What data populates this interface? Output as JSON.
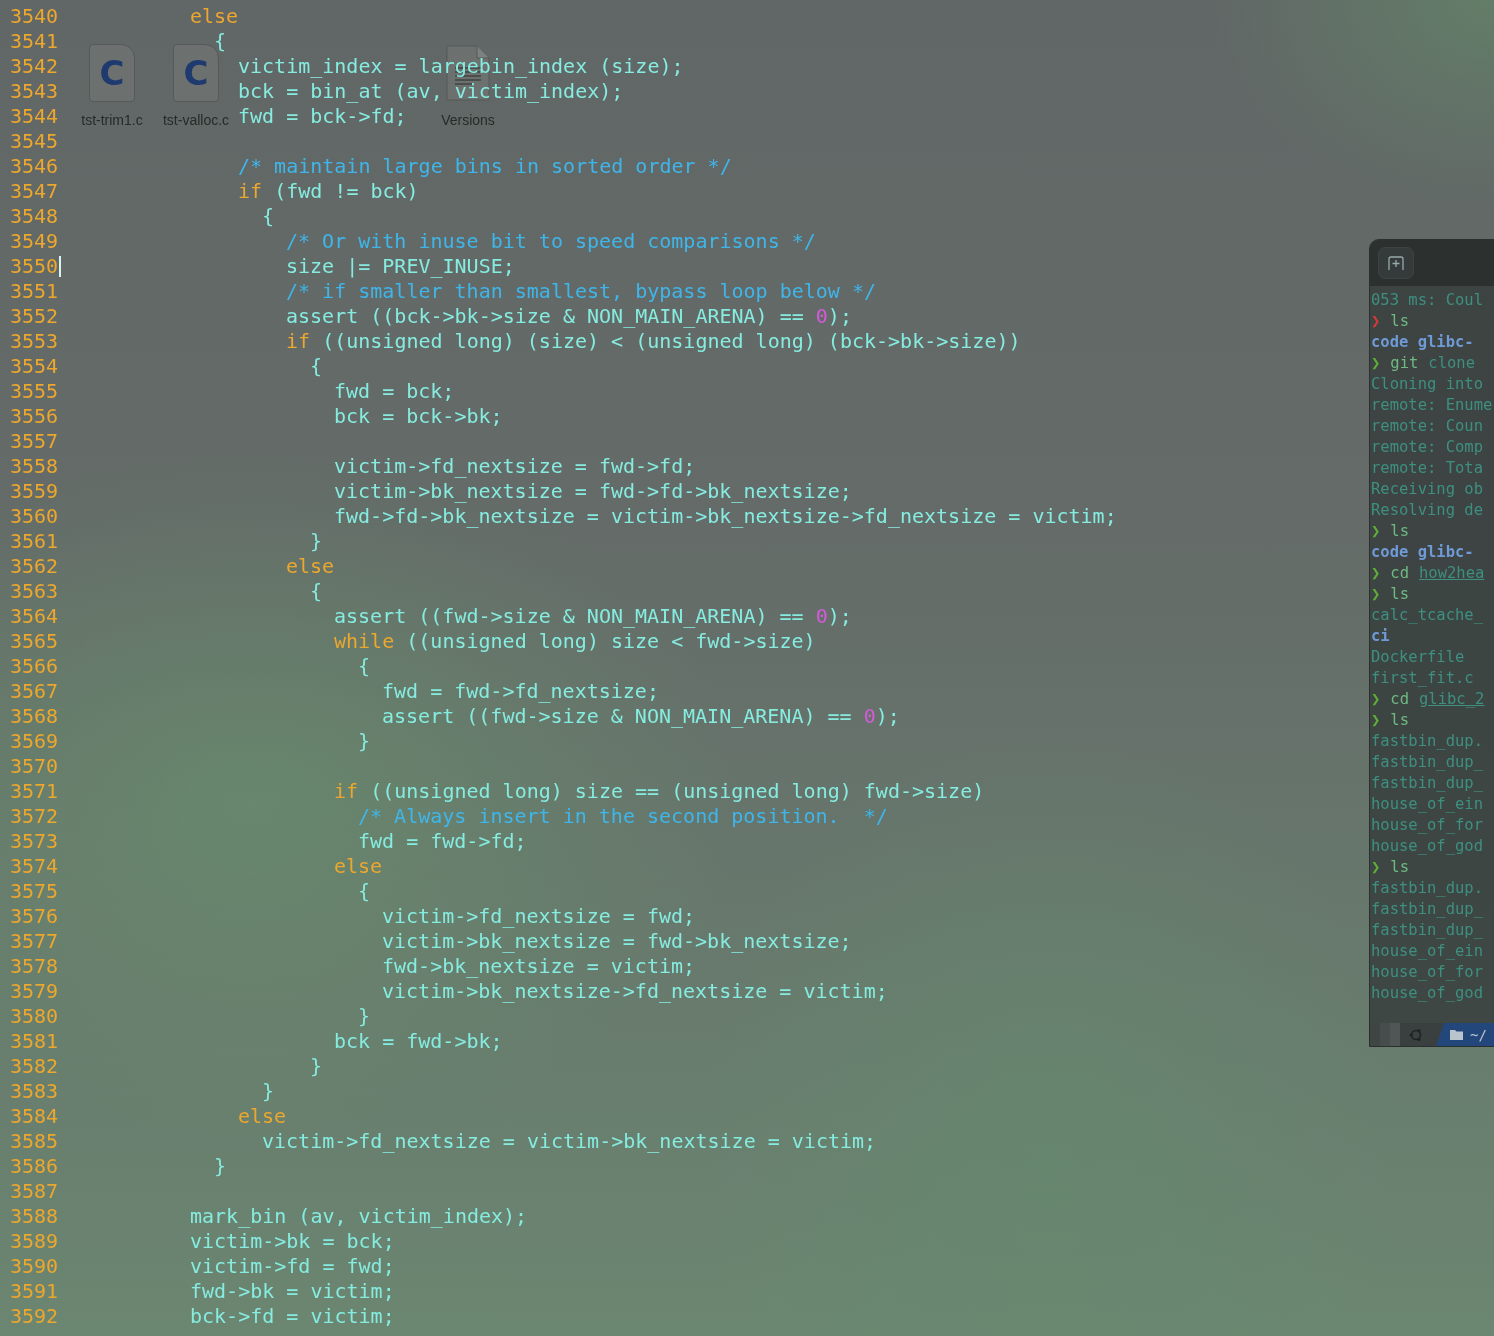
{
  "desktop": {
    "icons": [
      {
        "label": "tst-trim1.c",
        "kind": "c-source",
        "glyph": "C"
      },
      {
        "label": "tst-valloc.c",
        "kind": "c-source",
        "glyph": "C"
      },
      {
        "label": "Versions",
        "kind": "text"
      }
    ]
  },
  "editor": {
    "lines": [
      {
        "num": "3540",
        "cursor": false,
        "segments": [
          {
            "kind": "keyword",
            "text": "          else"
          }
        ]
      },
      {
        "num": "3541",
        "cursor": false,
        "segments": [
          {
            "kind": "plain",
            "text": "            {"
          }
        ]
      },
      {
        "num": "3542",
        "cursor": false,
        "segments": [
          {
            "kind": "plain",
            "text": "              victim_index = largebin_index (size);"
          }
        ]
      },
      {
        "num": "3543",
        "cursor": false,
        "segments": [
          {
            "kind": "plain",
            "text": "              bck = bin_at (av, victim_index);"
          }
        ]
      },
      {
        "num": "3544",
        "cursor": false,
        "segments": [
          {
            "kind": "plain",
            "text": "              fwd = bck->fd;"
          }
        ]
      },
      {
        "num": "3545",
        "cursor": false
      },
      {
        "num": "3546",
        "cursor": false,
        "segments": [
          {
            "kind": "comment",
            "text": "              /* maintain large bins in sorted order */"
          }
        ]
      },
      {
        "num": "3547",
        "cursor": false,
        "segments": [
          {
            "kind": "keyword",
            "text": "              if"
          },
          {
            "kind": "plain",
            "text": " (fwd != bck)"
          }
        ]
      },
      {
        "num": "3548",
        "cursor": false,
        "segments": [
          {
            "kind": "plain",
            "text": "                {"
          }
        ]
      },
      {
        "num": "3549",
        "cursor": false,
        "segments": [
          {
            "kind": "comment",
            "text": "                  /* Or with inuse bit to speed comparisons */"
          }
        ]
      },
      {
        "num": "3550",
        "cursor": true,
        "segments": [
          {
            "kind": "plain",
            "text": "                  size |= PREV_INUSE;"
          }
        ]
      },
      {
        "num": "3551",
        "cursor": false,
        "segments": [
          {
            "kind": "comment",
            "text": "                  /* if smaller than smallest, bypass loop below */"
          }
        ]
      },
      {
        "num": "3552",
        "cursor": false,
        "segments": [
          {
            "kind": "plain",
            "text": "                  assert ((bck->bk->size & NON_MAIN_ARENA) == "
          },
          {
            "kind": "number",
            "text": "0"
          },
          {
            "kind": "plain",
            "text": ");"
          }
        ]
      },
      {
        "num": "3553",
        "cursor": false,
        "segments": [
          {
            "kind": "keyword",
            "text": "                  if"
          },
          {
            "kind": "plain",
            "text": " ((unsigned long) (size) < (unsigned long) (bck->bk->size))"
          }
        ]
      },
      {
        "num": "3554",
        "cursor": false,
        "segments": [
          {
            "kind": "plain",
            "text": "                    {"
          }
        ]
      },
      {
        "num": "3555",
        "cursor": false,
        "segments": [
          {
            "kind": "plain",
            "text": "                      fwd = bck;"
          }
        ]
      },
      {
        "num": "3556",
        "cursor": false,
        "segments": [
          {
            "kind": "plain",
            "text": "                      bck = bck->bk;"
          }
        ]
      },
      {
        "num": "3557",
        "cursor": false
      },
      {
        "num": "3558",
        "cursor": false,
        "segments": [
          {
            "kind": "plain",
            "text": "                      victim->fd_nextsize = fwd->fd;"
          }
        ]
      },
      {
        "num": "3559",
        "cursor": false,
        "segments": [
          {
            "kind": "plain",
            "text": "                      victim->bk_nextsize = fwd->fd->bk_nextsize;"
          }
        ]
      },
      {
        "num": "3560",
        "cursor": false,
        "segments": [
          {
            "kind": "plain",
            "text": "                      fwd->fd->bk_nextsize = victim->bk_nextsize->fd_nextsize = victim;"
          }
        ]
      },
      {
        "num": "3561",
        "cursor": false,
        "segments": [
          {
            "kind": "plain",
            "text": "                    }"
          }
        ]
      },
      {
        "num": "3562",
        "cursor": false,
        "segments": [
          {
            "kind": "keyword",
            "text": "                  else"
          }
        ]
      },
      {
        "num": "3563",
        "cursor": false,
        "segments": [
          {
            "kind": "plain",
            "text": "                    {"
          }
        ]
      },
      {
        "num": "3564",
        "cursor": false,
        "segments": [
          {
            "kind": "plain",
            "text": "                      assert ((fwd->size & NON_MAIN_ARENA) == "
          },
          {
            "kind": "number",
            "text": "0"
          },
          {
            "kind": "plain",
            "text": ");"
          }
        ]
      },
      {
        "num": "3565",
        "cursor": false,
        "segments": [
          {
            "kind": "keyword",
            "text": "                      while"
          },
          {
            "kind": "plain",
            "text": " ((unsigned long) size < fwd->size)"
          }
        ]
      },
      {
        "num": "3566",
        "cursor": false,
        "segments": [
          {
            "kind": "plain",
            "text": "                        {"
          }
        ]
      },
      {
        "num": "3567",
        "cursor": false,
        "segments": [
          {
            "kind": "plain",
            "text": "                          fwd = fwd->fd_nextsize;"
          }
        ]
      },
      {
        "num": "3568",
        "cursor": false,
        "segments": [
          {
            "kind": "plain",
            "text": "                          assert ((fwd->size & NON_MAIN_ARENA) == "
          },
          {
            "kind": "number",
            "text": "0"
          },
          {
            "kind": "plain",
            "text": ");"
          }
        ]
      },
      {
        "num": "3569",
        "cursor": false,
        "segments": [
          {
            "kind": "plain",
            "text": "                        }"
          }
        ]
      },
      {
        "num": "3570",
        "cursor": false
      },
      {
        "num": "3571",
        "cursor": false,
        "segments": [
          {
            "kind": "keyword",
            "text": "                      if"
          },
          {
            "kind": "plain",
            "text": " ((unsigned long) size == (unsigned long) fwd->size)"
          }
        ]
      },
      {
        "num": "3572",
        "cursor": false,
        "segments": [
          {
            "kind": "comment",
            "text": "                        /* Always insert in the second position.  */"
          }
        ]
      },
      {
        "num": "3573",
        "cursor": false,
        "segments": [
          {
            "kind": "plain",
            "text": "                        fwd = fwd->fd;"
          }
        ]
      },
      {
        "num": "3574",
        "cursor": false,
        "segments": [
          {
            "kind": "keyword",
            "text": "                      else"
          }
        ]
      },
      {
        "num": "3575",
        "cursor": false,
        "segments": [
          {
            "kind": "plain",
            "text": "                        {"
          }
        ]
      },
      {
        "num": "3576",
        "cursor": false,
        "segments": [
          {
            "kind": "plain",
            "text": "                          victim->fd_nextsize = fwd;"
          }
        ]
      },
      {
        "num": "3577",
        "cursor": false,
        "segments": [
          {
            "kind": "plain",
            "text": "                          victim->bk_nextsize = fwd->bk_nextsize;"
          }
        ]
      },
      {
        "num": "3578",
        "cursor": false,
        "segments": [
          {
            "kind": "plain",
            "text": "                          fwd->bk_nextsize = victim;"
          }
        ]
      },
      {
        "num": "3579",
        "cursor": false,
        "segments": [
          {
            "kind": "plain",
            "text": "                          victim->bk_nextsize->fd_nextsize = victim;"
          }
        ]
      },
      {
        "num": "3580",
        "cursor": false,
        "segments": [
          {
            "kind": "plain",
            "text": "                        }"
          }
        ]
      },
      {
        "num": "3581",
        "cursor": false,
        "segments": [
          {
            "kind": "plain",
            "text": "                      bck = fwd->bk;"
          }
        ]
      },
      {
        "num": "3582",
        "cursor": false,
        "segments": [
          {
            "kind": "plain",
            "text": "                    }"
          }
        ]
      },
      {
        "num": "3583",
        "cursor": false,
        "segments": [
          {
            "kind": "plain",
            "text": "                }"
          }
        ]
      },
      {
        "num": "3584",
        "cursor": false,
        "segments": [
          {
            "kind": "keyword",
            "text": "              else"
          }
        ]
      },
      {
        "num": "3585",
        "cursor": false,
        "segments": [
          {
            "kind": "plain",
            "text": "                victim->fd_nextsize = victim->bk_nextsize = victim;"
          }
        ]
      },
      {
        "num": "3586",
        "cursor": false,
        "segments": [
          {
            "kind": "plain",
            "text": "            }"
          }
        ]
      },
      {
        "num": "3587",
        "cursor": false
      },
      {
        "num": "3588",
        "cursor": false,
        "segments": [
          {
            "kind": "plain",
            "text": "          mark_bin (av, victim_index);"
          }
        ]
      },
      {
        "num": "3589",
        "cursor": false,
        "segments": [
          {
            "kind": "plain",
            "text": "          victim->bk = bck;"
          }
        ]
      },
      {
        "num": "3590",
        "cursor": false,
        "segments": [
          {
            "kind": "plain",
            "text": "          victim->fd = fwd;"
          }
        ]
      },
      {
        "num": "3591",
        "cursor": false,
        "segments": [
          {
            "kind": "plain",
            "text": "          fwd->bk = victim;"
          }
        ]
      },
      {
        "num": "3592",
        "cursor": false,
        "segments": [
          {
            "kind": "plain",
            "text": "          bck->fd = victim;"
          }
        ]
      }
    ]
  },
  "terminal": {
    "lines": [
      {
        "kind": "output",
        "text": "053 ms: Coul"
      },
      {
        "kind": "prompt",
        "failed": true,
        "command": "ls"
      },
      {
        "kind": "dirs",
        "text": "code  glibc-"
      },
      {
        "kind": "prompt",
        "failed": false,
        "command": "git",
        "args": "clone"
      },
      {
        "kind": "output",
        "text": "Cloning into"
      },
      {
        "kind": "output",
        "text": "remote: Enume"
      },
      {
        "kind": "output",
        "text": "remote: Coun"
      },
      {
        "kind": "output",
        "text": "remote: Comp"
      },
      {
        "kind": "output",
        "text": "remote: Tota"
      },
      {
        "kind": "output",
        "text": "Receiving ob"
      },
      {
        "kind": "output",
        "text": "Resolving de"
      },
      {
        "kind": "prompt",
        "failed": false,
        "command": "ls"
      },
      {
        "kind": "dirs",
        "text": "code  glibc-"
      },
      {
        "kind": "prompt",
        "failed": false,
        "command": "cd",
        "link": "how2hea"
      },
      {
        "kind": "prompt",
        "failed": false,
        "command": "ls"
      },
      {
        "kind": "output",
        "text": "calc_tcache_"
      },
      {
        "kind": "dirs",
        "text": "ci"
      },
      {
        "kind": "output",
        "text": "Dockerfile"
      },
      {
        "kind": "output",
        "text": "first_fit.c"
      },
      {
        "kind": "prompt",
        "failed": false,
        "command": "cd",
        "link": "glibc_2"
      },
      {
        "kind": "prompt",
        "failed": false,
        "command": "ls"
      },
      {
        "kind": "output",
        "text": "fastbin_dup."
      },
      {
        "kind": "output",
        "text": "fastbin_dup_"
      },
      {
        "kind": "output",
        "text": "fastbin_dup_"
      },
      {
        "kind": "output",
        "text": "house_of_ein"
      },
      {
        "kind": "output",
        "text": "house_of_for"
      },
      {
        "kind": "output",
        "text": "house_of_god"
      },
      {
        "kind": "prompt",
        "failed": false,
        "command": "ls"
      },
      {
        "kind": "output",
        "text": "fastbin_dup."
      },
      {
        "kind": "output",
        "text": "fastbin_dup_"
      },
      {
        "kind": "output",
        "text": "fastbin_dup_"
      },
      {
        "kind": "output",
        "text": "house_of_ein"
      },
      {
        "kind": "output",
        "text": "house_of_for"
      },
      {
        "kind": "output",
        "text": "house_of_god"
      }
    ],
    "prompt_symbol": "❯",
    "status_bar": {
      "path": "~/"
    }
  }
}
